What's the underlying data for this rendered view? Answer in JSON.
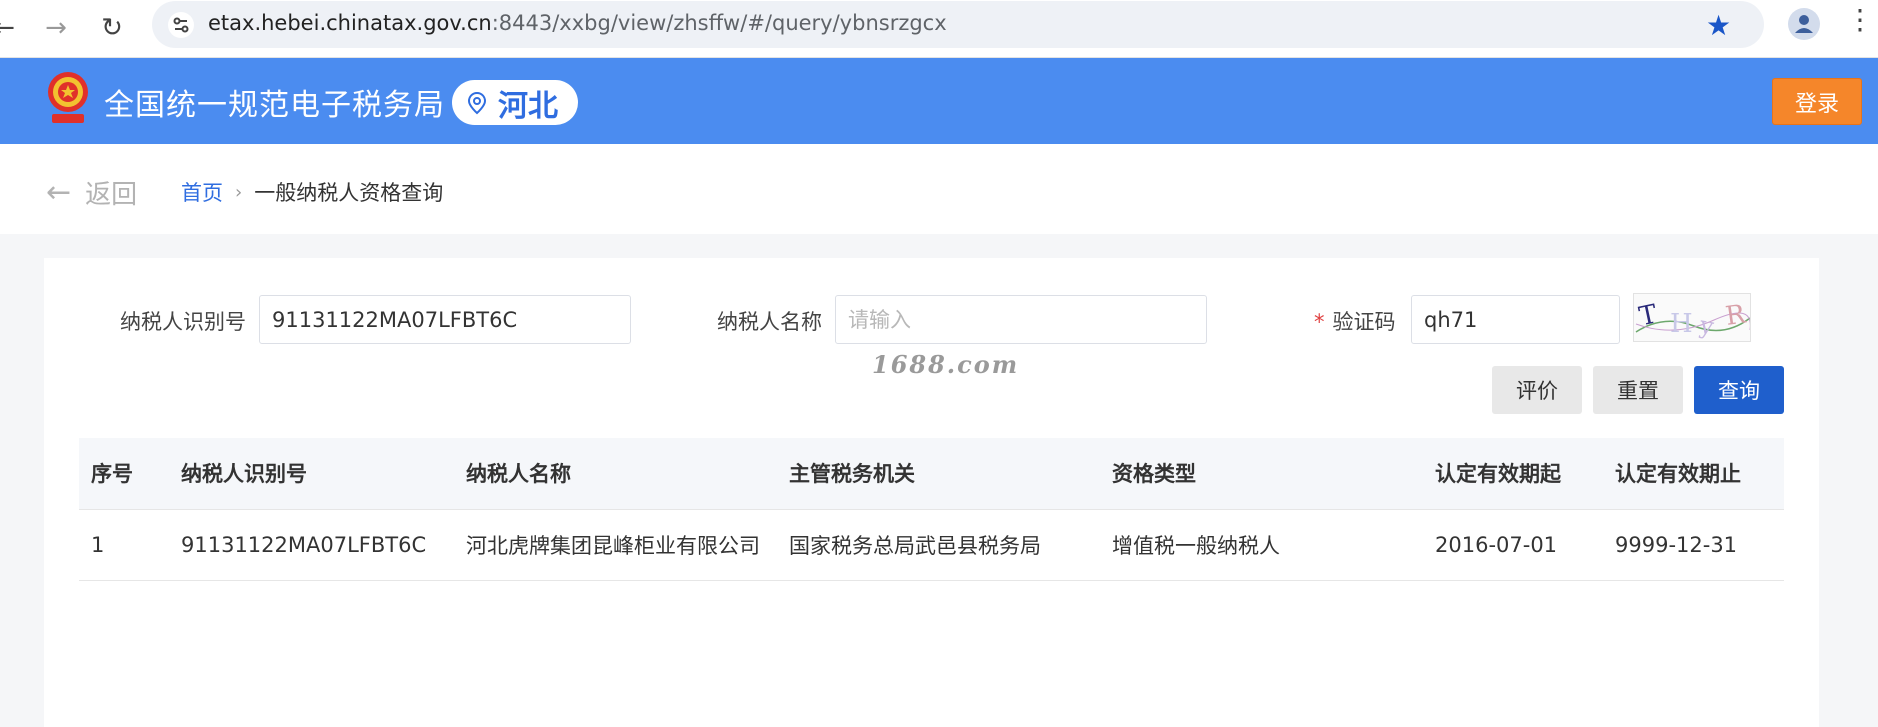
{
  "browser": {
    "url_host": "etax.hebei.chinatax.gov.cn",
    "url_path": ":8443/xxbg/view/zhsffw/#/query/ybnsrzgcx"
  },
  "header": {
    "site_title": "全国统一规范电子税务局",
    "region": "河北",
    "login_label": "登录",
    "brand_color": "#4b8cf0",
    "login_color": "#f5862a"
  },
  "breadcrumb": {
    "back_label": "返回",
    "home": "首页",
    "current": "一般纳税人资格查询"
  },
  "form": {
    "taxpayer_id_label": "纳税人识别号",
    "taxpayer_id_value": "91131122MA07LFBT6C",
    "taxpayer_name_label": "纳税人名称",
    "taxpayer_name_placeholder": "请输入",
    "captcha_label": "验证码",
    "captcha_required_mark": "*",
    "captcha_value": "qh71",
    "captcha_image_text": "THyR"
  },
  "watermark": "1688.com",
  "actions": {
    "rate_label": "评价",
    "reset_label": "重置",
    "search_label": "查询"
  },
  "table": {
    "headers": [
      "序号",
      "纳税人识别号",
      "纳税人名称",
      "主管税务机关",
      "资格类型",
      "认定有效期起",
      "认定有效期止"
    ],
    "rows": [
      [
        "1",
        "91131122MA07LFBT6C",
        "河北虎牌集团昆峰柜业有限公司",
        "国家税务总局武邑县税务局",
        "增值税一般纳税人",
        "2016-07-01",
        "9999-12-31"
      ]
    ]
  }
}
